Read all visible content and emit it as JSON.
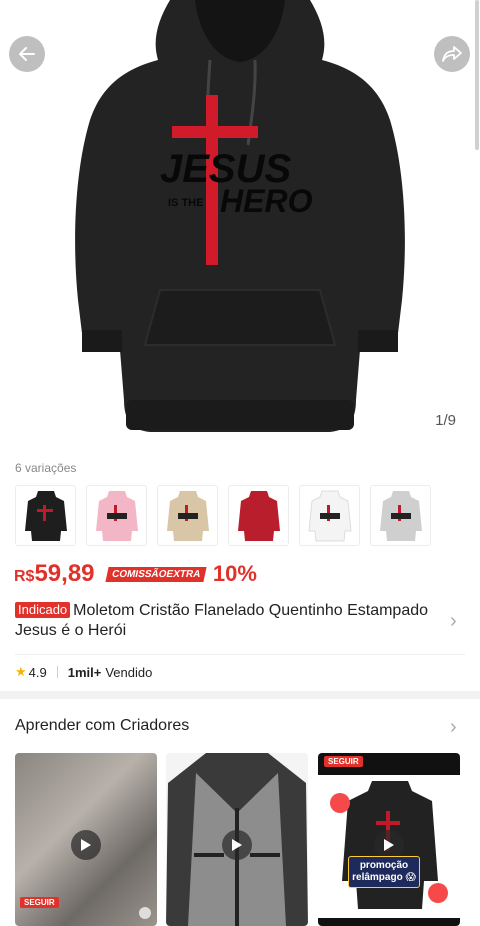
{
  "gallery": {
    "counter": "1/9",
    "print_line1": "JESUS",
    "print_line2_small": "IS THE",
    "print_line2_big": "HERO"
  },
  "variations": {
    "label": "6 variações",
    "colors": [
      "#1e1e1e",
      "#f2b6c6",
      "#d8c6a6",
      "#b81e2b",
      "#f4f4f4",
      "#cfcfcf"
    ]
  },
  "price": {
    "currency": "R$",
    "amount": "59,89",
    "commission_badge": "COMISSÃOEXTRA",
    "commission_value": "10%"
  },
  "product": {
    "tag": "Indicado",
    "title": "Moletom Cristão Flanelado Quentinho Estampado Jesus é o Herói"
  },
  "stats": {
    "rating": "4.9",
    "sold_count": "1mil+",
    "sold_label": "Vendido"
  },
  "creators": {
    "title": "Aprender com Criadores",
    "cards": [
      {
        "follow_label": "SEGUIR"
      },
      {},
      {
        "follow_label": "SEGUIR",
        "promo_text": "promoção relâmpago 😱"
      }
    ]
  },
  "colors": {
    "accent": "#e0312b",
    "hoodie": "#232323",
    "star": "#f5b400"
  }
}
